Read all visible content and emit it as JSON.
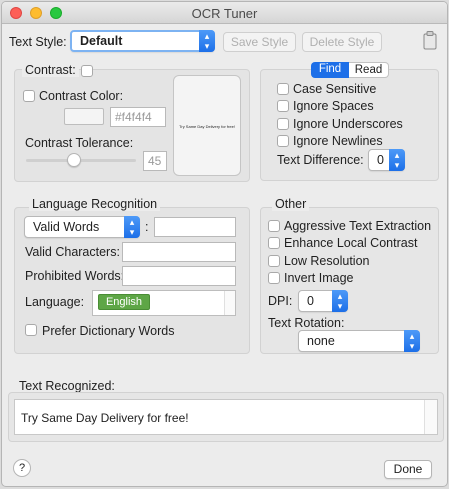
{
  "window": {
    "title": "OCR Tuner"
  },
  "text_style": {
    "label": "Text Style:",
    "value": "Default",
    "save_label": "Save Style",
    "delete_label": "Delete Style"
  },
  "contrast": {
    "title": "Contrast:",
    "color_label": "Contrast Color:",
    "color_value": "#f4f4f4",
    "tolerance_label": "Contrast Tolerance:",
    "tolerance_value": "45",
    "preview_text": "Try Same Day Delivery for free!"
  },
  "find": {
    "tabs": [
      "Find",
      "Read"
    ],
    "options": [
      "Case Sensitive",
      "Ignore Spaces",
      "Ignore Underscores",
      "Ignore Newlines"
    ],
    "difference_label": "Text Difference:",
    "difference_value": "0"
  },
  "language": {
    "title": "Language Recognition",
    "mode_value": "Valid Words",
    "colon": ":",
    "valid_chars_label": "Valid Characters:",
    "prohibited_label": "Prohibited Words:",
    "language_label": "Language:",
    "language_token": "English",
    "prefer_label": "Prefer Dictionary Words"
  },
  "other": {
    "title": "Other",
    "options": [
      "Aggressive Text Extraction",
      "Enhance Local Contrast",
      "Low Resolution",
      "Invert Image"
    ],
    "dpi_label": "DPI:",
    "dpi_value": "0",
    "rotation_label": "Text Rotation:",
    "rotation_value": "none"
  },
  "recognized": {
    "label": "Text Recognized:",
    "text": "Try Same Day Delivery for free!"
  },
  "footer": {
    "help": "?",
    "done": "Done"
  },
  "colors": {
    "accent": "#1d6fe8",
    "token_green": "#5ea646",
    "focus_ring": "#7db3f2"
  },
  "icons": {
    "clipboard": "clipboard-icon",
    "updown": "updown-chevron-icon"
  }
}
